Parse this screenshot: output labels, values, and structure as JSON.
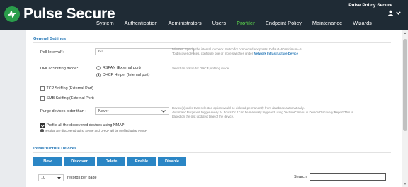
{
  "header": {
    "brand": "Pulse Secure",
    "product_name": "Pulse Policy Secure",
    "nav": [
      {
        "label": "System",
        "active": false
      },
      {
        "label": "Authentication",
        "active": false
      },
      {
        "label": "Administrators",
        "active": false
      },
      {
        "label": "Users",
        "active": false
      },
      {
        "label": "Profiler",
        "active": true
      },
      {
        "label": "Endpoint Policy",
        "active": false
      },
      {
        "label": "Maintenance",
        "active": false
      },
      {
        "label": "Wizards",
        "active": false
      }
    ]
  },
  "general": {
    "title": "General Settings",
    "poll_interval": {
      "label": "Poll Interval*:",
      "value": "60",
      "hint_line1": "Minutes: Specify the interval to check Switch for connected endpoints. Default=60 minimum=5",
      "hint_line2": "To discover devices, configure one or more switches under ",
      "hint_link": "Network Infrastructure Device"
    },
    "dhcp": {
      "label": "DHCP Sniffing mode*:",
      "options": [
        {
          "label": "RSPAN (External port)",
          "selected": false
        },
        {
          "label": "DHCP Helper (Internal port)",
          "selected": true
        }
      ],
      "hint": "Select an option for DHCP profiling mode."
    },
    "tcp_sniffing": {
      "label": "TCP Sniffing (External Port)",
      "checked": false
    },
    "smb_sniffing": {
      "label": "SMB Sniffing (External Port)",
      "checked": false
    },
    "purge": {
      "label": "Purge devices older than :",
      "value": "Never",
      "hint_line1": "Device(s) older than selected option would be deleted permanently from database automatically.",
      "hint_line2": "Automatic Purge will trigger every 24 hours Or it can be manually triggered using \"Actions\" menu in Device Discovery Report This is",
      "hint_line3": "based on the last updated time of the device."
    },
    "nmap": {
      "label": "Profile all the discovered devices using NMAP",
      "checked": true,
      "note": "IPs that are discovered using SNMP and DHCP will be profiled using NMAP"
    }
  },
  "infrastructure": {
    "title": "Infrastructure Devices",
    "buttons": [
      "New",
      "Discover",
      "Delete",
      "Enable",
      "Disable"
    ],
    "per_page_value": "10",
    "per_page_label": "records per page",
    "search_label": "Search:"
  },
  "colors": {
    "header_bg": "#1f2b35",
    "brand_green": "#51b848",
    "accent_blue": "#2b86c5"
  }
}
